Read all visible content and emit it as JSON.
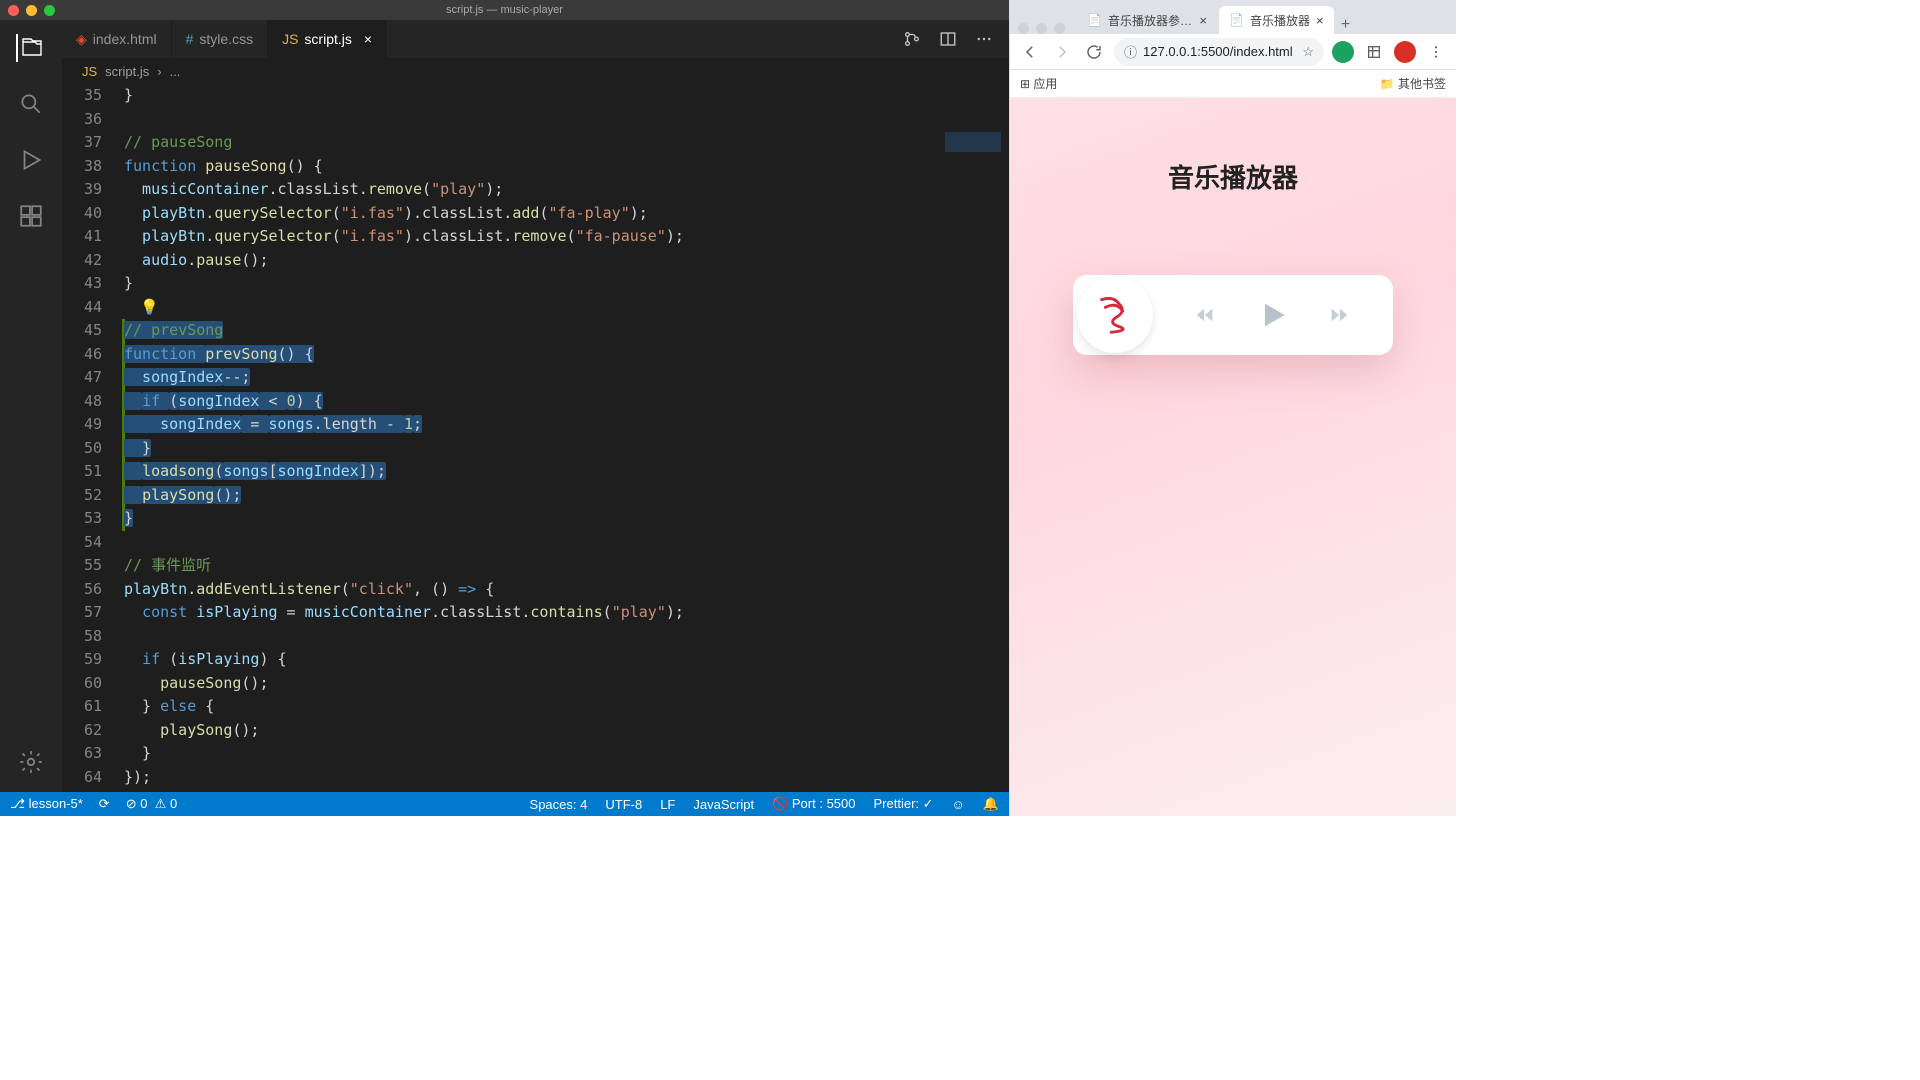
{
  "vscode": {
    "window_title": "script.js — music-player",
    "tabs": [
      {
        "icon": "html5",
        "label": "index.html",
        "active": false
      },
      {
        "icon": "css",
        "label": "style.css",
        "active": false
      },
      {
        "icon": "js",
        "label": "script.js",
        "active": true
      }
    ],
    "breadcrumb": {
      "file": "script.js",
      "sep": "›",
      "rest": "..."
    },
    "gutter_start": 35,
    "lines": [
      [
        {
          "t": "}",
          "c": "p"
        }
      ],
      [],
      [
        {
          "t": "// pauseSong",
          "c": "c"
        }
      ],
      [
        {
          "t": "function ",
          "c": "k"
        },
        {
          "t": "pauseSong",
          "c": "fn"
        },
        {
          "t": "() {",
          "c": "p"
        }
      ],
      [
        {
          "t": "  musicContainer",
          "c": "v"
        },
        {
          "t": ".classList.",
          "c": "p"
        },
        {
          "t": "remove",
          "c": "fn"
        },
        {
          "t": "(",
          "c": "p"
        },
        {
          "t": "\"play\"",
          "c": "s"
        },
        {
          "t": ");",
          "c": "p"
        }
      ],
      [
        {
          "t": "  playBtn",
          "c": "v"
        },
        {
          "t": ".",
          "c": "p"
        },
        {
          "t": "querySelector",
          "c": "fn"
        },
        {
          "t": "(",
          "c": "p"
        },
        {
          "t": "\"i.fas\"",
          "c": "s"
        },
        {
          "t": ").classList.",
          "c": "p"
        },
        {
          "t": "add",
          "c": "fn"
        },
        {
          "t": "(",
          "c": "p"
        },
        {
          "t": "\"fa-play\"",
          "c": "s"
        },
        {
          "t": ");",
          "c": "p"
        }
      ],
      [
        {
          "t": "  playBtn",
          "c": "v"
        },
        {
          "t": ".",
          "c": "p"
        },
        {
          "t": "querySelector",
          "c": "fn"
        },
        {
          "t": "(",
          "c": "p"
        },
        {
          "t": "\"i.fas\"",
          "c": "s"
        },
        {
          "t": ").classList.",
          "c": "p"
        },
        {
          "t": "remove",
          "c": "fn"
        },
        {
          "t": "(",
          "c": "p"
        },
        {
          "t": "\"fa-pause\"",
          "c": "s"
        },
        {
          "t": ");",
          "c": "p"
        }
      ],
      [
        {
          "t": "  audio",
          "c": "v"
        },
        {
          "t": ".",
          "c": "p"
        },
        {
          "t": "pause",
          "c": "fn"
        },
        {
          "t": "();",
          "c": "p"
        }
      ],
      [
        {
          "t": "}",
          "c": "p"
        }
      ],
      [],
      [
        {
          "t": "// prevSong",
          "c": "c",
          "sel": true
        }
      ],
      [
        {
          "t": "function ",
          "c": "k",
          "sel": true
        },
        {
          "t": "prevSong",
          "c": "fn",
          "sel": true
        },
        {
          "t": "() {",
          "c": "p",
          "sel": true
        }
      ],
      [
        {
          "t": "  songIndex",
          "c": "v",
          "sel": true
        },
        {
          "t": "--;",
          "c": "p",
          "sel": true
        }
      ],
      [
        {
          "t": "  ",
          "sel": true
        },
        {
          "t": "if ",
          "c": "k",
          "sel": true
        },
        {
          "t": "(",
          "c": "p",
          "sel": true
        },
        {
          "t": "songIndex",
          "c": "v",
          "sel": true
        },
        {
          "t": " < ",
          "c": "op",
          "sel": true
        },
        {
          "t": "0",
          "c": "n",
          "sel": true
        },
        {
          "t": ") {",
          "c": "p",
          "sel": true
        }
      ],
      [
        {
          "t": "    songIndex",
          "c": "v",
          "sel": true
        },
        {
          "t": " = ",
          "c": "op",
          "sel": true
        },
        {
          "t": "songs",
          "c": "v",
          "sel": true
        },
        {
          "t": ".length - ",
          "c": "p",
          "sel": true
        },
        {
          "t": "1",
          "c": "n",
          "sel": true
        },
        {
          "t": ";",
          "c": "p",
          "sel": true
        }
      ],
      [
        {
          "t": "  }",
          "c": "p",
          "sel": true
        }
      ],
      [
        {
          "t": "  ",
          "sel": true
        },
        {
          "t": "loadsong",
          "c": "fn",
          "sel": true
        },
        {
          "t": "(",
          "c": "p",
          "sel": true
        },
        {
          "t": "songs",
          "c": "v",
          "sel": true
        },
        {
          "t": "[",
          "c": "p",
          "sel": true
        },
        {
          "t": "songIndex",
          "c": "v",
          "sel": true
        },
        {
          "t": "]);",
          "c": "p",
          "sel": true
        }
      ],
      [
        {
          "t": "  ",
          "sel": true
        },
        {
          "t": "playSong",
          "c": "fn",
          "sel": true
        },
        {
          "t": "();",
          "c": "p",
          "sel": true
        }
      ],
      [
        {
          "t": "}",
          "c": "p",
          "sel": true
        }
      ],
      [],
      [
        {
          "t": "// 事件监听",
          "c": "c"
        }
      ],
      [
        {
          "t": "playBtn",
          "c": "v"
        },
        {
          "t": ".",
          "c": "p"
        },
        {
          "t": "addEventListener",
          "c": "fn"
        },
        {
          "t": "(",
          "c": "p"
        },
        {
          "t": "\"click\"",
          "c": "s"
        },
        {
          "t": ", () ",
          "c": "p"
        },
        {
          "t": "=>",
          "c": "k"
        },
        {
          "t": " {",
          "c": "p"
        }
      ],
      [
        {
          "t": "  ",
          "c": "p"
        },
        {
          "t": "const ",
          "c": "k"
        },
        {
          "t": "isPlaying",
          "c": "v"
        },
        {
          "t": " = ",
          "c": "op"
        },
        {
          "t": "musicContainer",
          "c": "v"
        },
        {
          "t": ".classList.",
          "c": "p"
        },
        {
          "t": "contains",
          "c": "fn"
        },
        {
          "t": "(",
          "c": "p"
        },
        {
          "t": "\"play\"",
          "c": "s"
        },
        {
          "t": ");",
          "c": "p"
        }
      ],
      [],
      [
        {
          "t": "  ",
          "c": "p"
        },
        {
          "t": "if ",
          "c": "k"
        },
        {
          "t": "(",
          "c": "p"
        },
        {
          "t": "isPlaying",
          "c": "v"
        },
        {
          "t": ") {",
          "c": "p"
        }
      ],
      [
        {
          "t": "    ",
          "c": "p"
        },
        {
          "t": "pauseSong",
          "c": "fn"
        },
        {
          "t": "();",
          "c": "p"
        }
      ],
      [
        {
          "t": "  } ",
          "c": "p"
        },
        {
          "t": "else",
          "c": "k"
        },
        {
          "t": " {",
          "c": "p"
        }
      ],
      [
        {
          "t": "    ",
          "c": "p"
        },
        {
          "t": "playSong",
          "c": "fn"
        },
        {
          "t": "();",
          "c": "p"
        }
      ],
      [
        {
          "t": "  }",
          "c": "p"
        }
      ],
      [
        {
          "t": "});",
          "c": "p"
        }
      ]
    ],
    "status": {
      "branch": "lesson-5*",
      "errors": "0",
      "warnings": "0",
      "spaces": "Spaces: 4",
      "encoding": "UTF-8",
      "eol": "LF",
      "lang": "JavaScript",
      "port": "Port : 5500",
      "prettier": "Prettier: ✓"
    }
  },
  "chrome": {
    "tabs": [
      {
        "label": "音乐播放器参照页",
        "active": false
      },
      {
        "label": "音乐播放器",
        "active": true
      }
    ],
    "url": "127.0.0.1:5500/index.html",
    "bookmarks_left": "应用",
    "bookmarks_right": "其他书签",
    "page_title": "音乐播放器"
  }
}
